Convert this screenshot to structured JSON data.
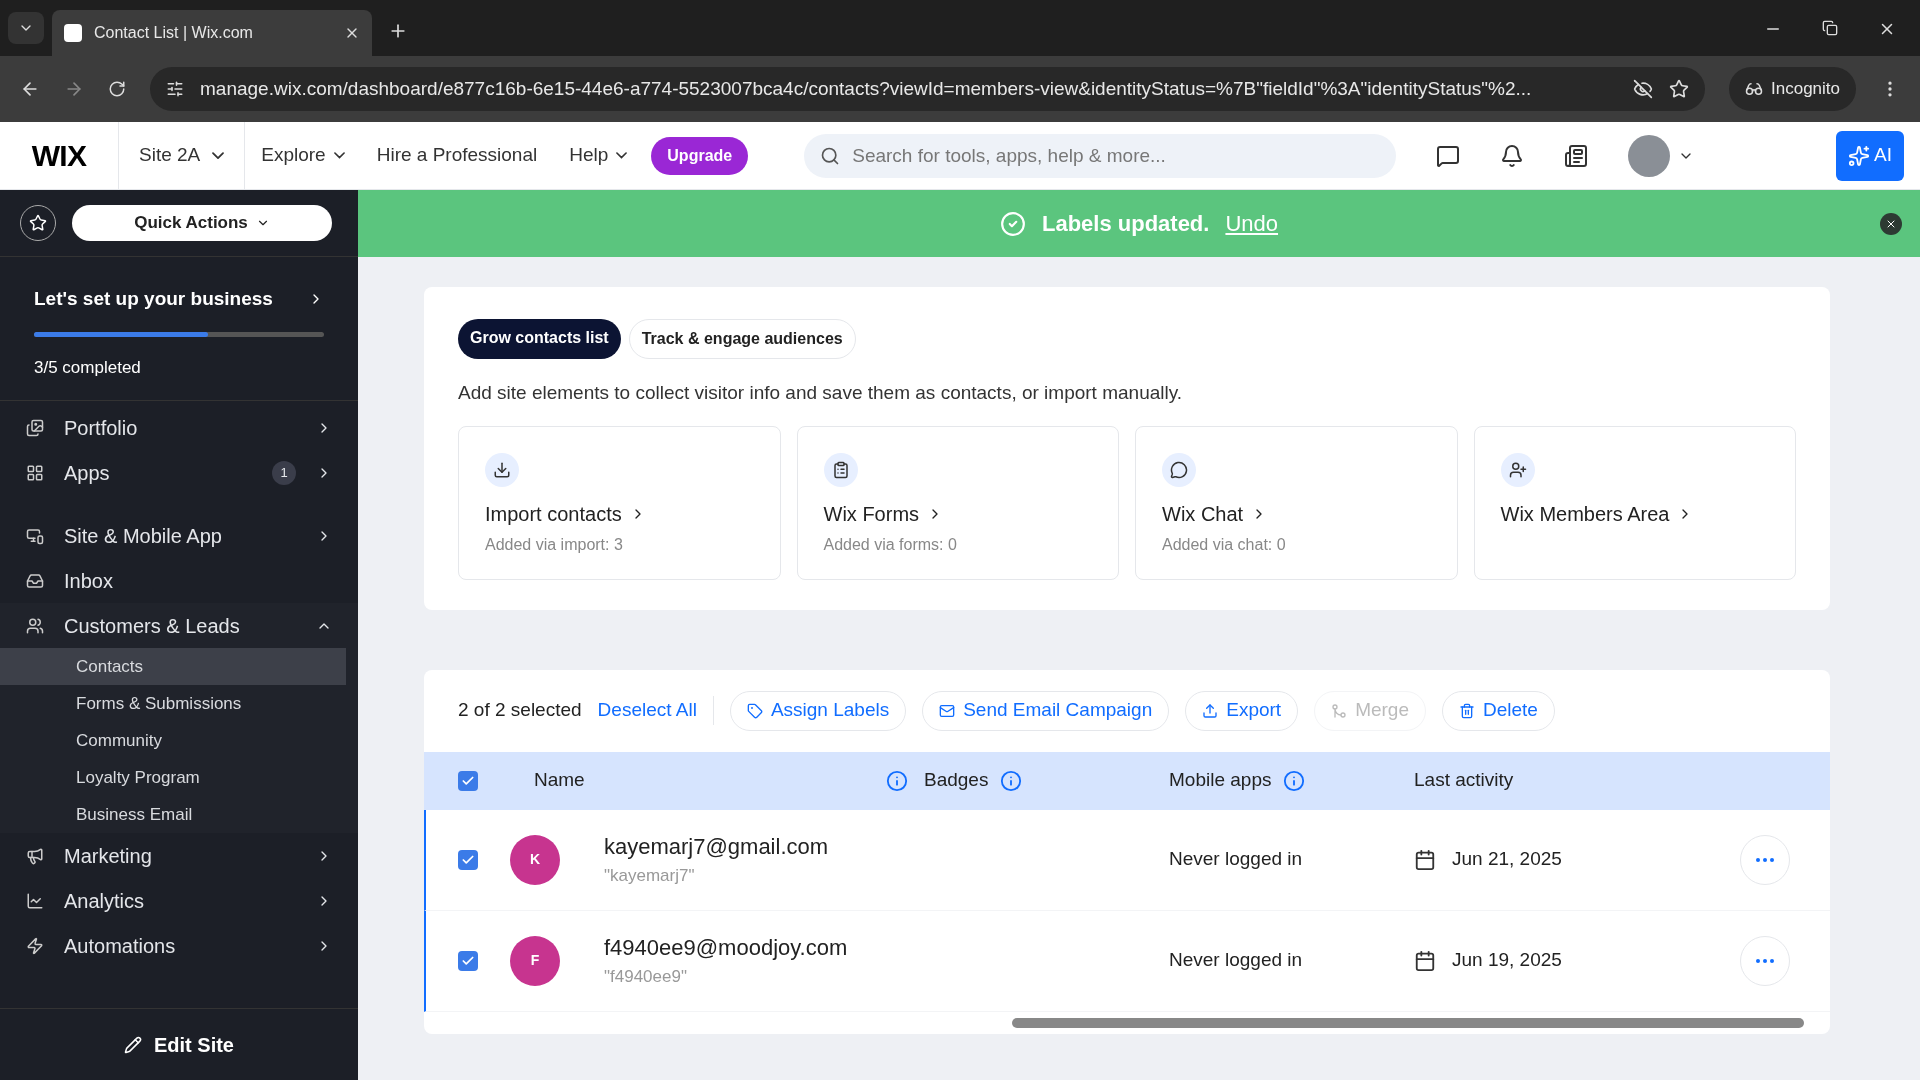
{
  "browser": {
    "tab_title": "Contact List | Wix.com",
    "url": "manage.wix.com/dashboard/e877c16b-6e15-44e6-a774-5523007bca4c/contacts?viewId=members-view&identityStatus=%7B\"fieldId\"%3A\"identityStatus\"%2...",
    "incognito": "Incognito"
  },
  "topbar": {
    "logo": "WIX",
    "site": "Site 2A",
    "nav": [
      "Explore",
      "Hire a Professional",
      "Help"
    ],
    "upgrade": "Upgrade",
    "search_placeholder": "Search for tools, apps, help & more...",
    "ai": "AI"
  },
  "sidebar": {
    "quick_actions": "Quick Actions",
    "setup": {
      "title": "Let's set up your business",
      "level": 0.6,
      "status": "3/5 completed"
    },
    "items": [
      {
        "label": "Portfolio",
        "expanded": false
      },
      {
        "label": "Apps",
        "badge": "1",
        "expanded": false
      },
      {
        "label": "Site & Mobile App",
        "expanded": false
      },
      {
        "label": "Inbox"
      },
      {
        "label": "Customers & Leads",
        "expanded": true,
        "children": [
          {
            "label": "Contacts",
            "selected": true
          },
          {
            "label": "Forms & Submissions",
            "selected": false
          },
          {
            "label": "Community",
            "selected": false
          },
          {
            "label": "Loyalty Program",
            "selected": false
          },
          {
            "label": "Business Email",
            "selected": false
          }
        ]
      },
      {
        "label": "Marketing",
        "expanded": false
      },
      {
        "label": "Analytics",
        "expanded": false
      },
      {
        "label": "Automations",
        "expanded": false
      }
    ],
    "edit_site": "Edit Site"
  },
  "toast": {
    "message": "Labels updated.",
    "action": "Undo"
  },
  "grow": {
    "tabs": [
      {
        "label": "Grow contacts list",
        "selected": true
      },
      {
        "label": "Track & engage audiences",
        "selected": false
      }
    ],
    "description": "Add site elements to collect visitor info and save them as contacts, or import manually.",
    "cards": [
      {
        "title": "Import contacts",
        "subtitle": "Added via import: 3"
      },
      {
        "title": "Wix Forms",
        "subtitle": "Added via forms: 0"
      },
      {
        "title": "Wix Chat",
        "subtitle": "Added via chat: 0"
      },
      {
        "title": "Wix Members Area"
      }
    ]
  },
  "table": {
    "selection": "2 of 2 selected",
    "deselect": "Deselect All",
    "actions": [
      {
        "label": "Assign Labels",
        "disabled": false
      },
      {
        "label": "Send Email Campaign",
        "disabled": false
      },
      {
        "label": "Export",
        "disabled": false
      },
      {
        "label": "Merge",
        "disabled": true
      },
      {
        "label": "Delete",
        "disabled": false
      }
    ],
    "all_checked": true,
    "columns": [
      "Name",
      "Badges",
      "Mobile apps",
      "Last activity"
    ],
    "rows": [
      {
        "checked": true,
        "initial": "K",
        "email": "kayemarj7@gmail.com",
        "nickname": "\"kayemarj7\"",
        "mobile": "Never logged in",
        "last_activity": "Jun 21, 2025"
      },
      {
        "checked": true,
        "initial": "F",
        "email": "f4940ee9@moodjoy.com",
        "nickname": "\"f4940ee9\"",
        "mobile": "Never logged in",
        "last_activity": "Jun 19, 2025"
      }
    ]
  }
}
